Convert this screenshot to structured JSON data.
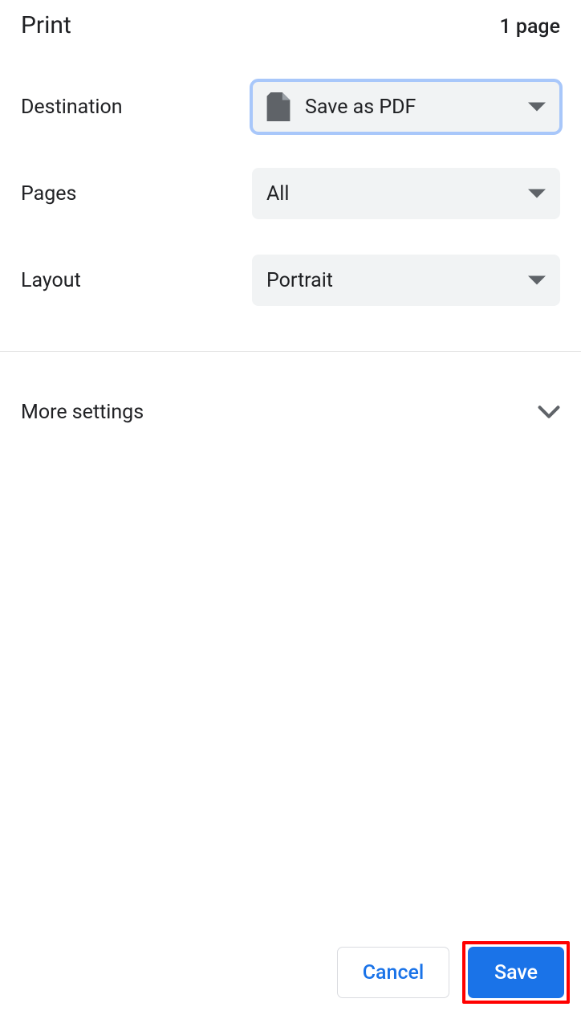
{
  "header": {
    "title": "Print",
    "page_count": "1 page"
  },
  "rows": {
    "destination": {
      "label": "Destination",
      "value": "Save as PDF"
    },
    "pages": {
      "label": "Pages",
      "value": "All"
    },
    "layout": {
      "label": "Layout",
      "value": "Portrait"
    }
  },
  "more_settings": {
    "label": "More settings"
  },
  "footer": {
    "cancel": "Cancel",
    "save": "Save"
  }
}
